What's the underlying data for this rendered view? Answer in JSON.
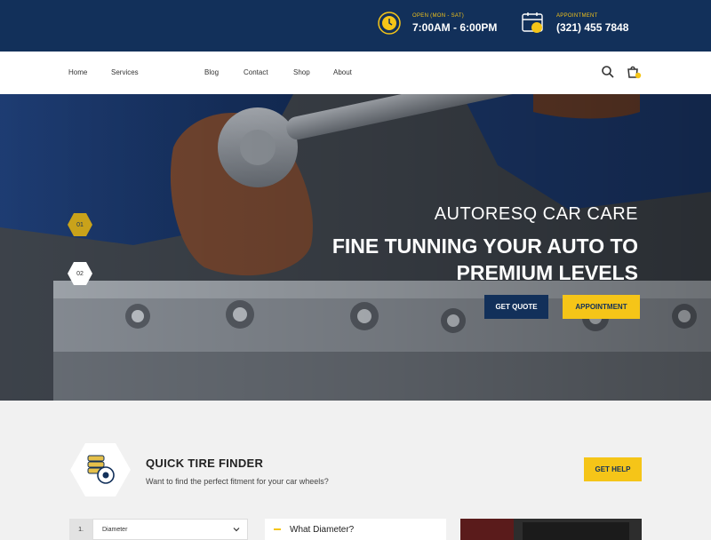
{
  "topbar": {
    "hours": {
      "label": "OPEN (MON - SAT)",
      "value": "7:00AM - 6:00PM",
      "icon": "clock-icon"
    },
    "appointment": {
      "label": "APPOINTMENT",
      "value": "(321) 455 7848",
      "icon": "calendar-icon"
    },
    "accent_color": "#f1c21b",
    "bg_color": "#12305a"
  },
  "nav": {
    "items": [
      "Home",
      "Services",
      "Blog",
      "Contact",
      "Shop",
      "About"
    ],
    "search_icon": "search-icon",
    "cart_icon": "cart-icon",
    "cart_count": "0"
  },
  "hero": {
    "eyebrow": "AUTORESQ CAR CARE",
    "headline": "FINE TUNNING YOUR AUTO TO PREMIUM LEVELS",
    "quote_button": "GET QUOTE",
    "appointment_button": "APPOINTMENT",
    "slides": [
      "01",
      "02"
    ],
    "active_slide": "01"
  },
  "finder": {
    "title": "QUICK TIRE FINDER",
    "subtitle": "Want to find the perfect fitment for your car wheels?",
    "help_button": "GET HELP",
    "step_number": "1.",
    "select_value": "Diameter",
    "faq_question": "What Diameter?"
  }
}
